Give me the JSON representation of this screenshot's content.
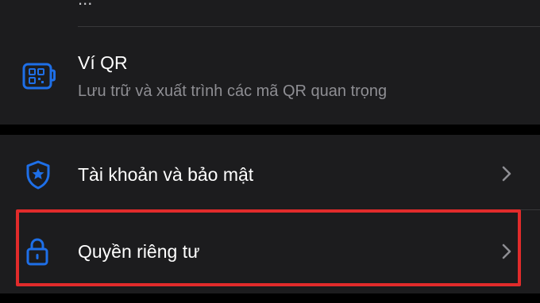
{
  "top_partial": {
    "text": "..."
  },
  "settings": {
    "qr_wallet": {
      "title": "Ví QR",
      "subtitle": "Lưu trữ và xuất trình các mã QR quan trọng",
      "icon": "qr-wallet-icon"
    },
    "account_security": {
      "title": "Tài khoản và bảo mật",
      "icon": "shield-star-icon"
    },
    "privacy": {
      "title": "Quyền riêng tư",
      "icon": "lock-icon"
    }
  },
  "colors": {
    "accent": "#1e6fe8",
    "highlight": "#e12b2b",
    "row_bg": "#1c1c1e",
    "subtitle": "#8e8e93"
  }
}
